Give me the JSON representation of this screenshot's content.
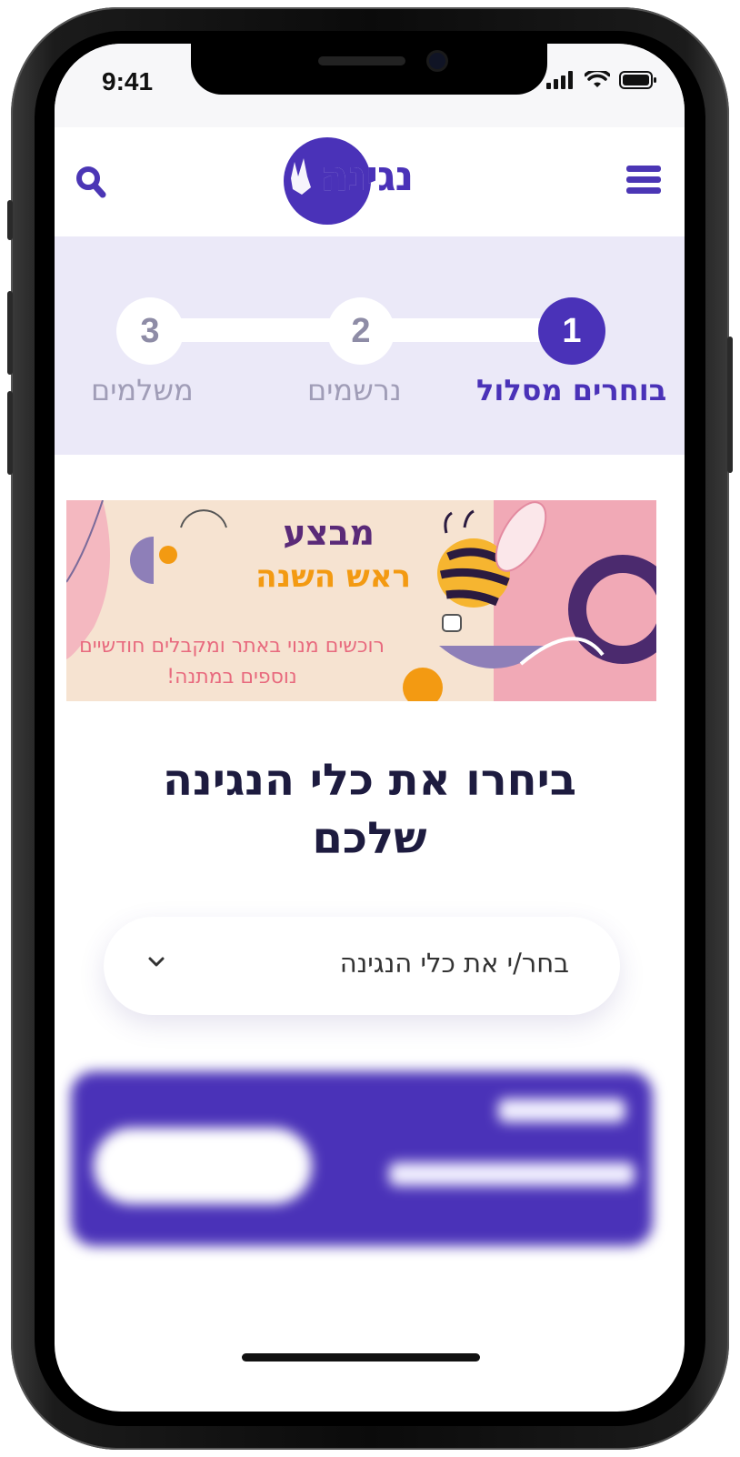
{
  "statusbar": {
    "time": "9:41"
  },
  "header": {
    "logo_text": "נגינה"
  },
  "steps": [
    {
      "number": "1",
      "label": "בוחרים מסלול",
      "active": true
    },
    {
      "number": "2",
      "label": "נרשמים",
      "active": false
    },
    {
      "number": "3",
      "label": "משלמים",
      "active": false
    }
  ],
  "banner": {
    "title": "מבצע",
    "subtitle": "ראש השנה",
    "text": "רוכשים מנוי באתר ומקבלים חודשיים נוספים במתנה!"
  },
  "main": {
    "heading_line1": "ביחרו את כלי הנגינה",
    "heading_line2": "שלכם",
    "dropdown_label": "בחר/י את כלי הנגינה"
  },
  "colors": {
    "brand": "#4a32b8",
    "stepper_bg": "#ebe9f8",
    "heading": "#1d1b3f",
    "banner_bg": "#f6e3d1"
  }
}
